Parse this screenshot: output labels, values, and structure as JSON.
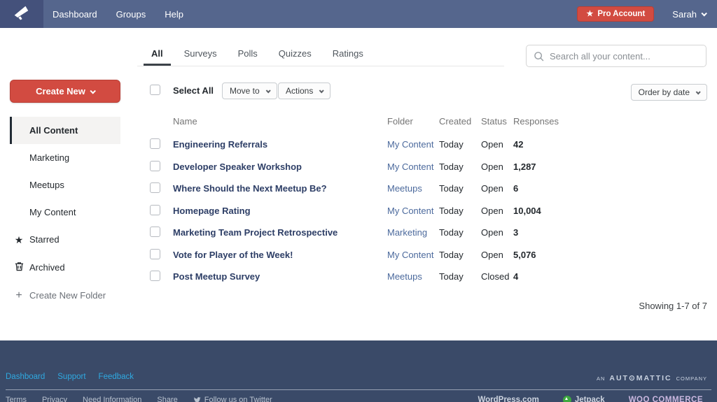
{
  "colors": {
    "navbar": "#55668d",
    "footer": "#3a4a68",
    "accent_red": "#d24b41",
    "link_blue": "#2fa9e1",
    "name_link": "#2d3e66",
    "folder_link": "#4c6a9d"
  },
  "icons": {
    "star": "★",
    "plus": "+",
    "automattic_o": "⊙"
  },
  "navbar": {
    "menu": [
      {
        "label": "Dashboard"
      },
      {
        "label": "Groups"
      },
      {
        "label": "Help"
      }
    ],
    "pro_account_label": "Pro Account",
    "user_name": "Sarah"
  },
  "tabs": [
    {
      "label": "All",
      "active": true
    },
    {
      "label": "Surveys",
      "active": false
    },
    {
      "label": "Polls",
      "active": false
    },
    {
      "label": "Quizzes",
      "active": false
    },
    {
      "label": "Ratings",
      "active": false
    }
  ],
  "search": {
    "placeholder": "Search all your content..."
  },
  "sidebar": {
    "create_new_label": "Create New",
    "folders": [
      {
        "label": "All Content",
        "active": true
      },
      {
        "label": "Marketing",
        "active": false
      },
      {
        "label": "Meetups",
        "active": false
      },
      {
        "label": "My Content",
        "active": false
      }
    ],
    "starred_label": "Starred",
    "archived_label": "Archived",
    "create_folder_label": "Create New Folder"
  },
  "toolbar": {
    "select_all_label": "Select All",
    "move_to_label": "Move to",
    "actions_label": "Actions",
    "order_by_label": "Order by date"
  },
  "table": {
    "columns": {
      "name": "Name",
      "folder": "Folder",
      "created": "Created",
      "status": "Status",
      "responses": "Responses"
    },
    "rows": [
      {
        "name": "Engineering Referrals",
        "folder": "My Content",
        "created": "Today",
        "status": "Open",
        "responses": "42"
      },
      {
        "name": "Developer Speaker Workshop",
        "folder": "My Content",
        "created": "Today",
        "status": "Open",
        "responses": "1,287"
      },
      {
        "name": "Where Should the Next Meetup Be?",
        "folder": "Meetups",
        "created": "Today",
        "status": "Open",
        "responses": "6"
      },
      {
        "name": "Homepage Rating",
        "folder": "My Content",
        "created": "Today",
        "status": "Open",
        "responses": "10,004"
      },
      {
        "name": "Marketing Team Project Retrospective",
        "folder": "Marketing",
        "created": "Today",
        "status": "Open",
        "responses": "3"
      },
      {
        "name": "Vote for Player of the Week!",
        "folder": "My Content",
        "created": "Today",
        "status": "Open",
        "responses": "5,076"
      },
      {
        "name": "Post Meetup Survey",
        "folder": "Meetups",
        "created": "Today",
        "status": "Closed",
        "responses": "4"
      }
    ],
    "showing_label": "Showing 1-7 of 7"
  },
  "footer": {
    "links": [
      {
        "label": "Dashboard"
      },
      {
        "label": "Support"
      },
      {
        "label": "Feedback"
      }
    ],
    "automattic": {
      "prefix": "AN",
      "brand": "AUT⊙MATTIC",
      "suffix": "COMPANY"
    },
    "bottom_links": [
      "Terms",
      "Privacy",
      "Need Information",
      "Share",
      "Follow us on Twitter"
    ],
    "partners": [
      "WordPress.com",
      "Jetpack",
      "WOO COMMERCE"
    ]
  }
}
